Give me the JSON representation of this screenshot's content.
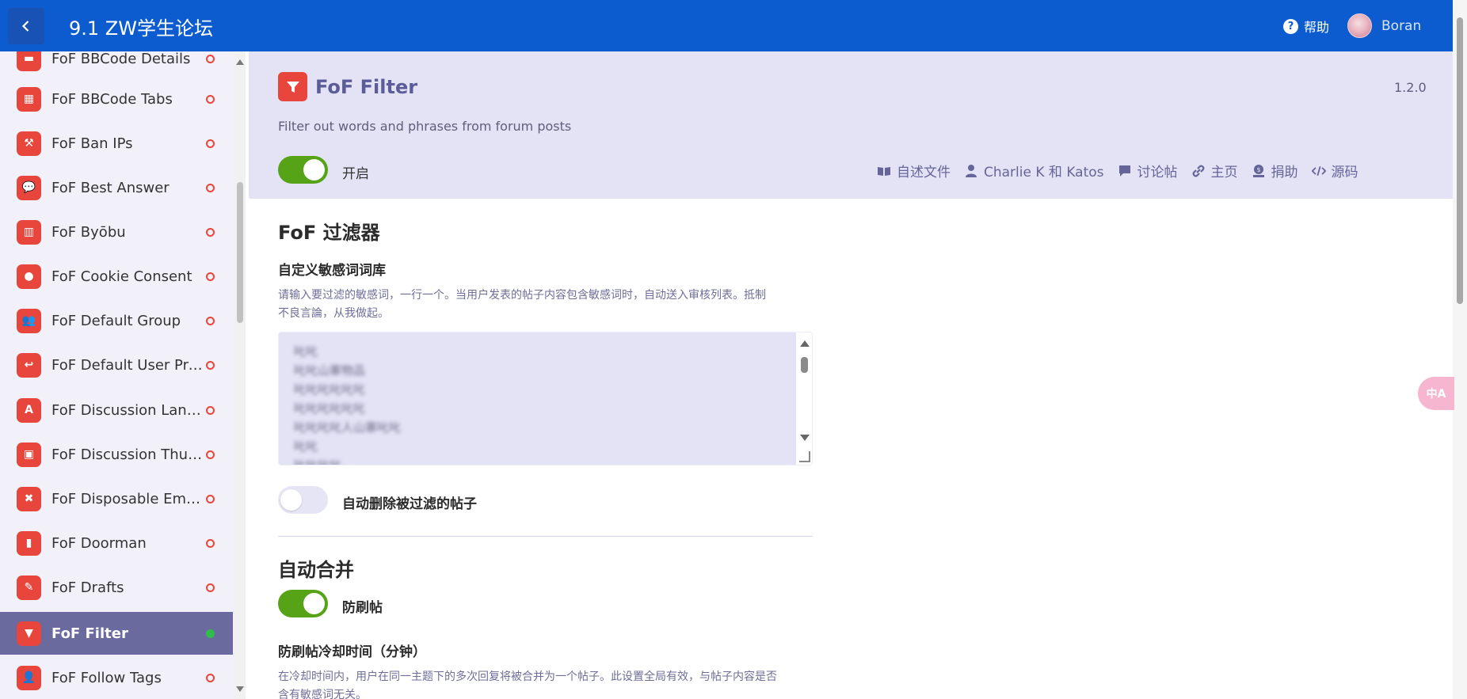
{
  "header": {
    "site_title": "9.1 ZW学生论坛",
    "help_label": "帮助",
    "username": "Boran",
    "color": "#0c5ccf"
  },
  "sidebar": {
    "items": [
      {
        "label": "FoF BBCode Details",
        "icon": "bbcode-details-icon",
        "enabled": false
      },
      {
        "label": "FoF BBCode Tabs",
        "icon": "table-icon",
        "enabled": false
      },
      {
        "label": "FoF Ban IPs",
        "icon": "gavel-icon",
        "enabled": false
      },
      {
        "label": "FoF Best Answer",
        "icon": "comment-dots-icon",
        "enabled": false
      },
      {
        "label": "FoF Byōbu",
        "icon": "map-icon",
        "enabled": false
      },
      {
        "label": "FoF Cookie Consent",
        "icon": "cookie-icon",
        "enabled": false
      },
      {
        "label": "FoF Default Group",
        "icon": "users-icon",
        "enabled": false
      },
      {
        "label": "FoF Default User Pref...",
        "icon": "reply-icon",
        "enabled": false
      },
      {
        "label": "FoF Discussion Langu...",
        "icon": "language-icon",
        "enabled": false
      },
      {
        "label": "FoF Discussion Thum...",
        "icon": "image-icon",
        "enabled": false
      },
      {
        "label": "FoF Disposable Emails",
        "icon": "user-times-icon",
        "enabled": false
      },
      {
        "label": "FoF Doorman",
        "icon": "door-icon",
        "enabled": false
      },
      {
        "label": "FoF Drafts",
        "icon": "edit-icon",
        "enabled": false
      },
      {
        "label": "FoF Filter",
        "icon": "filter-icon",
        "enabled": true,
        "active": true
      },
      {
        "label": "FoF Follow Tags",
        "icon": "user-tag-icon",
        "enabled": false
      }
    ]
  },
  "extension": {
    "title": "FoF Filter",
    "version": "1.2.0",
    "description": "Filter out words and phrases from forum posts",
    "enabled_label": "开启",
    "enabled": true,
    "links": {
      "readme": "自述文件",
      "authors": "Charlie K 和 Katos",
      "discussion": "讨论帖",
      "homepage": "主页",
      "donate": "捐助",
      "source": "源码"
    }
  },
  "settings": {
    "filter_section_title": "FoF 过滤器",
    "word_list_label": "自定义敏感词词库",
    "word_list_help": "请输入要过滤的敏感词，一行一个。当用户发表的帖子内容包含敏感词时，自动送入审核列表。抵制\n不良言論，从我做起。",
    "word_list_lines": [
      "叱叱",
      "叱叱山寨物品",
      "叱叱叱叱叱叱",
      "叱叱叱叱叱叱",
      "叱叱叱叱人山寨叱叱",
      "叱叱",
      "叱叱叱叱"
    ],
    "auto_delete_label": "自动删除被过滤的帖子",
    "auto_delete_enabled": false,
    "merge_section_title": "自动合并",
    "flood_label": "防刷帖",
    "flood_enabled": true,
    "cooldown_label": "防刷帖冷却时间（分钟）",
    "cooldown_help": "在冷却时间内，用户在同一主题下的多次回复将被合并为一个帖子。此设置全局有效，与帖子内容是否\n含有敏感词无关。"
  },
  "translate_badge": "中A"
}
